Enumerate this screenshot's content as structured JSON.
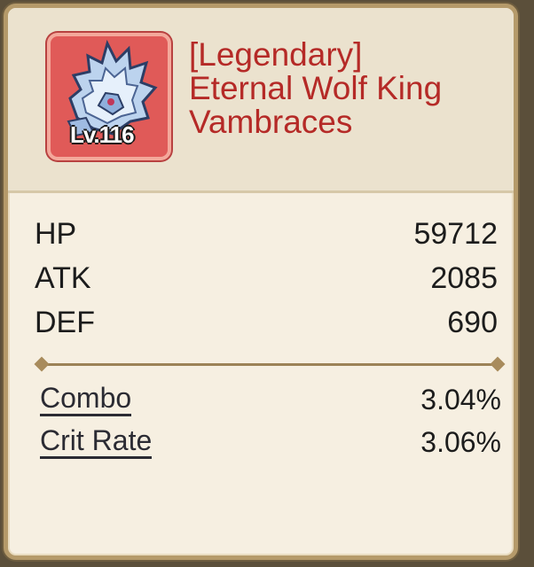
{
  "item": {
    "level_label": "Lv.116",
    "name_lines": [
      "[Legendary]",
      "Eternal Wolf King",
      "Vambraces"
    ],
    "rarity_color": "#b52a27",
    "icon": "wolf-king-vambraces-icon"
  },
  "stats": [
    {
      "label": "HP",
      "value": "59712"
    },
    {
      "label": "ATK",
      "value": "2085"
    },
    {
      "label": "DEF",
      "value": "690"
    }
  ],
  "sub_stats": [
    {
      "label": "Combo",
      "value": "3.04%"
    },
    {
      "label": "Crit Rate",
      "value": "3.06%"
    }
  ]
}
